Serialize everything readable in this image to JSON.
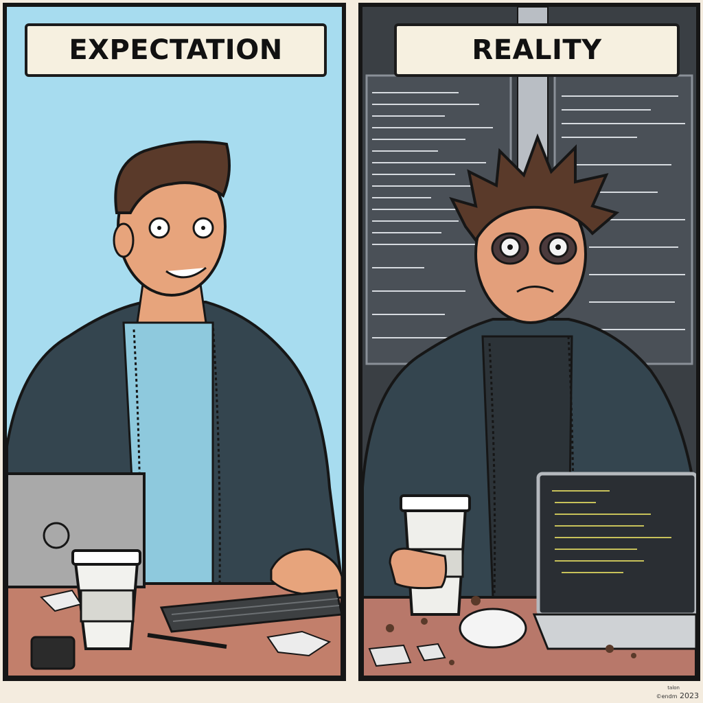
{
  "panels": {
    "left": {
      "caption": "EXPECTATION"
    },
    "right": {
      "caption": "REALITY"
    }
  },
  "signature": {
    "name": "talon",
    "handle": "©endm",
    "year": "2023"
  },
  "colors": {
    "left_background": "#a7dcef",
    "right_background": "#3a3f44",
    "hoodie": "#34454f",
    "skin": "#e7a47c",
    "desk": "#c27f6b",
    "caption_fill": "#f6f0e0",
    "outline": "#161616"
  },
  "icons": [
    "laptop-icon",
    "coffee-cup-icon",
    "keyboard-icon",
    "phone-icon",
    "mouse-icon"
  ]
}
